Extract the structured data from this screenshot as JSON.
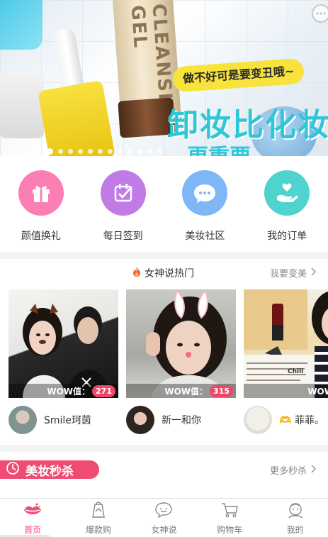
{
  "banner": {
    "product_text": "CLEANSING GEL",
    "pill_text": "做不好可是要变丑哦~",
    "slogan": "卸妆比化妆",
    "slogan_line2": "更重要",
    "dot_count": 12,
    "active_dot": 0
  },
  "quick_menu": [
    {
      "label": "颜值换礼",
      "icon": "gift-icon",
      "color": "#fb7fb5"
    },
    {
      "label": "每日签到",
      "icon": "calendar-check-icon",
      "color": "#c17be6"
    },
    {
      "label": "美妆社区",
      "icon": "chat-bubble-icon",
      "color": "#7fb6f6"
    },
    {
      "label": "我的订单",
      "icon": "hand-heart-icon",
      "color": "#4fd3cf"
    }
  ],
  "hot": {
    "title": "女神说热门",
    "more_label": "我要变美",
    "wow_label": "WOW值：",
    "cards": [
      {
        "wow": "271",
        "user": "Smile珂茵"
      },
      {
        "wow": "315",
        "user": "新一和你"
      },
      {
        "wow": "",
        "user": "🫶 菲菲。",
        "thumb_text": "Chili"
      }
    ]
  },
  "flash_sale": {
    "title": "美妆秒杀",
    "more_label": "更多秒杀"
  },
  "tabbar": [
    {
      "label": "首页",
      "icon": "lips-icon",
      "active": true
    },
    {
      "label": "爆款购",
      "icon": "shopping-tag-icon",
      "active": false
    },
    {
      "label": "女神说",
      "icon": "smile-bubble-icon",
      "active": false
    },
    {
      "label": "购物车",
      "icon": "cart-icon",
      "active": false
    },
    {
      "label": "我的",
      "icon": "profile-icon",
      "active": false
    }
  ],
  "colors": {
    "accent": "#f04b73",
    "wow_badge": "#f2456a",
    "banner_text": "#2fc7d8"
  }
}
